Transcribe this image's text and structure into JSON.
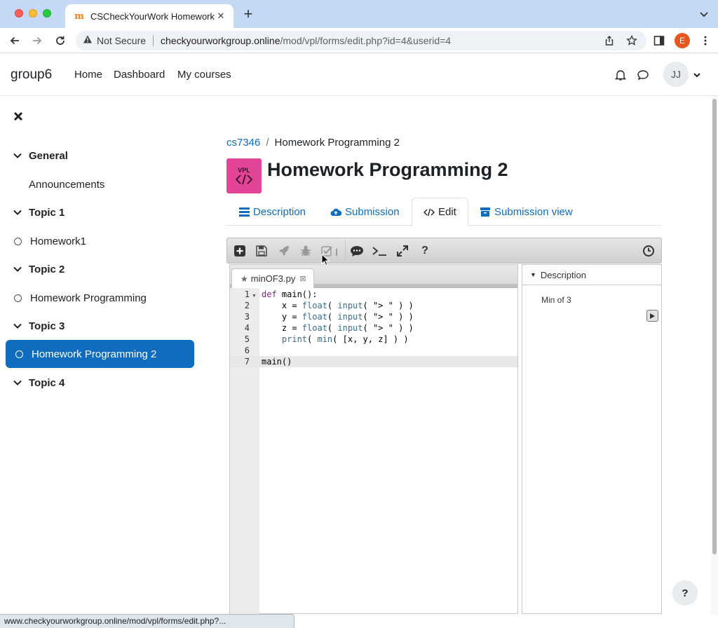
{
  "browser": {
    "tab_title": "CSCheckYourWork Homework",
    "security_label": "Not Secure",
    "url_host": "checkyourworkgroup.online",
    "url_path": "/mod/vpl/forms/edit.php?id=4&userid=4",
    "profile_initial": "E",
    "status_url": "www.checkyourworkgroup.online/mod/vpl/forms/edit.php?..."
  },
  "navbar": {
    "brand": "group6",
    "links": [
      "Home",
      "Dashboard",
      "My courses"
    ],
    "user_initials": "JJ"
  },
  "drawer": {
    "sections": [
      {
        "title": "General",
        "items": [
          "Announcements"
        ]
      },
      {
        "title": "Topic 1",
        "items": [
          "Homework1"
        ]
      },
      {
        "title": "Topic 2",
        "items": [
          "Homework Programming"
        ]
      },
      {
        "title": "Topic 3",
        "items": [
          "Homework Programming 2"
        ]
      },
      {
        "title": "Topic 4",
        "items": []
      }
    ],
    "active_item": "Homework Programming 2"
  },
  "breadcrumb": {
    "course": "cs7346",
    "current": "Homework Programming 2"
  },
  "activity": {
    "icon_text": "VPL",
    "title": "Homework Programming 2"
  },
  "tabs": [
    "Description",
    "Submission",
    "Edit",
    "Submission view"
  ],
  "active_tab": "Edit",
  "editor": {
    "file_name": "minOF3.py",
    "line_numbers": [
      "1",
      "2",
      "3",
      "4",
      "5",
      "6",
      "7"
    ],
    "lines": [
      "def main():",
      "    x = float( input( \"> \" ) )",
      "    y = float( input( \"> \" ) )",
      "    z = float( input( \"> \" ) )",
      "    print( min( [x, y, z] ) )",
      "",
      "main()"
    ],
    "active_line": 7
  },
  "description_panel": {
    "header": "Description",
    "text": "Min of 3"
  },
  "colors": {
    "accent": "#0f6cbf",
    "vpl_icon": "#e24496",
    "tabstrip": "#c5d8f5"
  }
}
